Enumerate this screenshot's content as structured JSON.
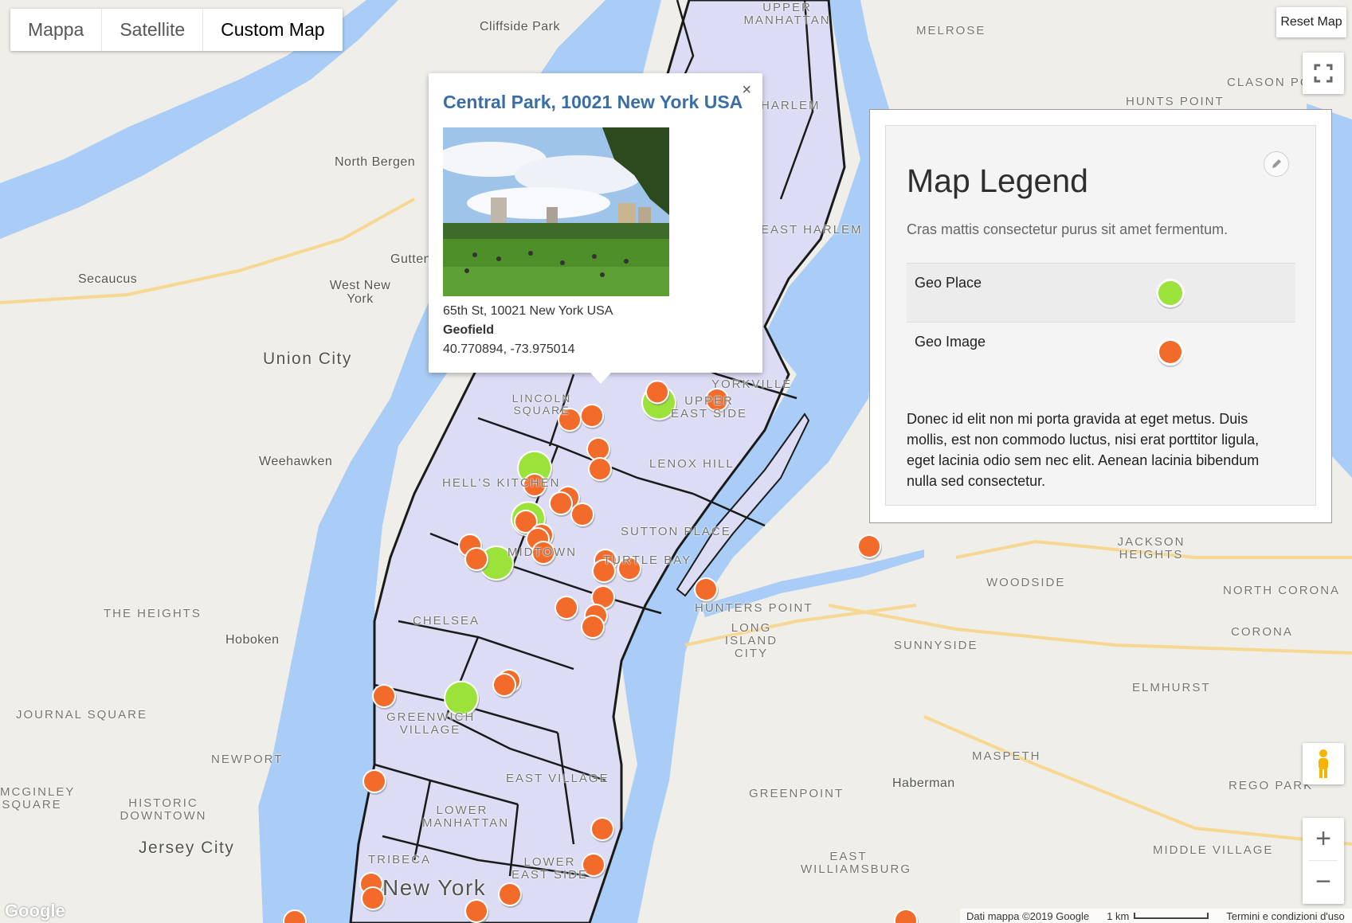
{
  "map_type": {
    "options": [
      "Mappa",
      "Satellite",
      "Custom Map"
    ],
    "selected": "Custom Map"
  },
  "controls": {
    "reset_label": "Reset Map",
    "fullscreen_icon": "fullscreen-icon",
    "zoom_in_symbol": "+",
    "zoom_out_symbol": "−",
    "pegman_icon": "pegman-icon"
  },
  "info_window": {
    "title": "Central Park, 10021 New York USA",
    "close_symbol": "×",
    "address": "65th St, 10021 New York USA",
    "field_label": "Geofield",
    "coordinates": "40.770894, -73.975014"
  },
  "legend": {
    "title": "Map Legend",
    "subtitle": "Cras mattis consectetur purus sit amet fermentum.",
    "items": [
      {
        "label": "Geo Place",
        "color": "#9be33a"
      },
      {
        "label": "Geo Image",
        "color": "#f26b2a"
      }
    ],
    "description": "Donec id elit non mi porta gravida at eget metus. Duis mollis, est non commodo luctus, nisi erat porttitor ligula, eget lacinia odio sem nec elit. Aenean lacinia bibendum nulla sed consectetur.",
    "edit_icon": "pencil-icon"
  },
  "footer": {
    "map_data": "Dati mappa ©2019 Google",
    "scale": "1 km",
    "terms": "Termini e condizioni d'uso",
    "logo": "Google"
  },
  "colors": {
    "water": "#a9cdf6",
    "land": "#efeee9",
    "highlight_area": "#dcdcf5",
    "geo_place": "#9be33a",
    "geo_image": "#f26b2a"
  },
  "place_labels": [
    "Cliffside Park",
    "UPPER MANHATTAN",
    "MELROSE",
    "North Bergen",
    "Gutten",
    "Secaucus",
    "West New York",
    "Union City",
    "Weehawken",
    "THE HEIGHTS",
    "Hoboken",
    "JOURNAL SQUARE",
    "NEWPORT",
    "MCGINLEY SQUARE",
    "HISTORIC DOWNTOWN",
    "Jersey City",
    "LINCOLN SQUARE",
    "YORKVILLE",
    "UPPER EAST SIDE",
    "LENOX HILL",
    "HELL'S KITCHEN",
    "MIDTOWN",
    "SUTTON PLACE",
    "TURTLE BAY",
    "CHELSEA",
    "GREENWICH VILLAGE",
    "EAST VILLAGE",
    "LOWER MANHATTAN",
    "TRIBECA",
    "LOWER EAST SIDE",
    "New York",
    "EAST HARLEM",
    "HUNTERS POINT",
    "LONG ISLAND CITY",
    "SUNNYSIDE",
    "WOODSIDE",
    "JACKSON HEIGHTS",
    "NORTH CORONA",
    "CORONA",
    "ELMHURST",
    "MASPETH",
    "Haberman",
    "GREENPOINT",
    "EAST WILLIAMSBURG",
    "REGO PARK",
    "MIDDLE VILLAGE",
    "CLASON POINT",
    "HUNTS POINT",
    "HARLEM"
  ],
  "markers": [
    {
      "type": "image",
      "lat": 40.7709,
      "lon": -73.975
    },
    {
      "type": "place",
      "lat": 40.774,
      "lon": -73.954
    },
    {
      "type": "image",
      "lat": 40.7765,
      "lon": -73.9545
    },
    {
      "type": "image",
      "lat": 40.763,
      "lon": -73.973
    },
    {
      "type": "place",
      "lat": 40.7585,
      "lon": -73.993
    },
    {
      "type": "place",
      "lat": 40.7465,
      "lon": -73.995
    },
    {
      "type": "place",
      "lat": 40.736,
      "lon": -74.005
    },
    {
      "type": "place",
      "lat": 40.704,
      "lon": -74.016
    }
  ]
}
